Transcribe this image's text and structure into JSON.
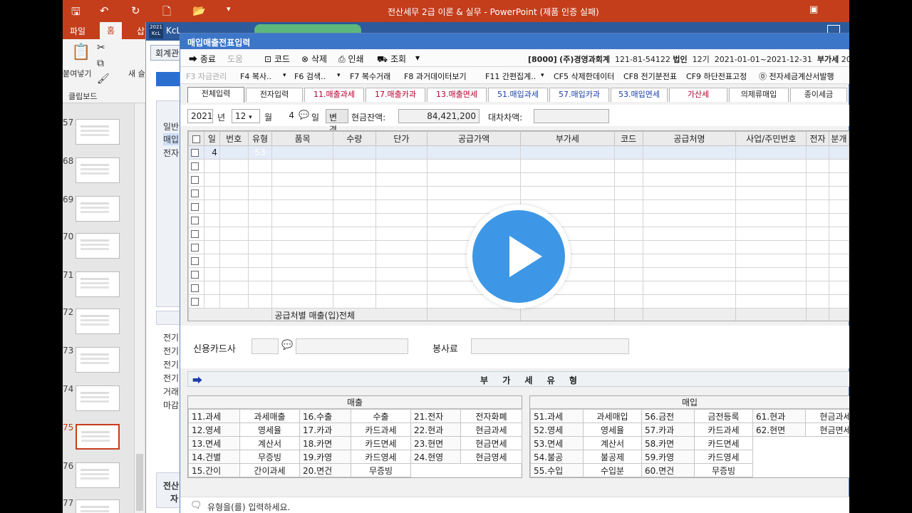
{
  "ppt": {
    "title": "전산세무 2급 이론 & 실무 - PowerPoint (제품 인증 실패)",
    "tabs": [
      "파일",
      "홈",
      "삽"
    ],
    "ribbon": {
      "paste": "붙여넣기",
      "new": "새 슬",
      "clipboard": "클립보드"
    },
    "thumb_numbers": [
      "57",
      "68",
      "69",
      "70",
      "71",
      "72",
      "73",
      "74",
      "75",
      "76",
      "77"
    ]
  },
  "bgapp": {
    "name": "KcL",
    "menu": "회계관",
    "side_items": [
      "일반",
      "매입",
      "전자"
    ],
    "side_items2": [
      "전기",
      "전기",
      "전기",
      "전기",
      "거래",
      "마감"
    ],
    "side_items3": [
      "전산",
      "자"
    ]
  },
  "dialog": {
    "title": "매입매출전표입력",
    "toolbar": {
      "close": "종료",
      "help": "도움",
      "code": "코드",
      "delete": "삭제",
      "print": "인쇄",
      "search": "조회",
      "company_code": "[8000]",
      "company": "(주)경영과회계",
      "biz_no": "121-81-54122",
      "type": "법인",
      "period_no": "12기",
      "period": "2021-01-01~2021-12-31",
      "vat": "부가세",
      "year_partial": "20"
    },
    "fkeys": [
      "F3 자금관리",
      "F4 복사..",
      "F6 검색..",
      "F7 복수거래",
      "F8 과거데이터보기",
      "F11 간편집계..",
      "CF5 삭제한데이터",
      "CF8 전기분전표",
      "CF9 하단전표고정",
      "전자세금계산서발행"
    ],
    "tabs": [
      "전체입력",
      "전자입력",
      "11.매출과세",
      "17.매출카과",
      "13.매출면세",
      "51.매입과세",
      "57.매입카과",
      "53.매입면세",
      "가산세",
      "의제류매입",
      "종이세금"
    ],
    "date": {
      "year": "2021",
      "year_label": "년",
      "month": "12",
      "month_label": "월",
      "day": "4",
      "day_label": "일",
      "change": "변경",
      "cash_label": "현금잔액:",
      "cash_value": "84,421,200",
      "diff_label": "대차차액:"
    },
    "grid": {
      "headers": [
        "일",
        "번호",
        "유형",
        "품목",
        "수량",
        "단가",
        "공급가액",
        "부가세",
        "코드",
        "공급처명",
        "사업/주민번호",
        "전자",
        "분개"
      ],
      "first_row": {
        "day": "4",
        "type": "53"
      },
      "summary": "공급처별 매출(입)전체"
    },
    "card": {
      "card_label": "신용카드사",
      "service_label": "봉사료"
    },
    "vat_title": "부 가 세 유 형",
    "sales": {
      "title": "매출",
      "rows": [
        [
          "11.과세",
          "과세매출",
          "16.수출",
          "수출",
          "21.전자",
          "전자화폐"
        ],
        [
          "12.영세",
          "영세율",
          "17.카과",
          "카드과세",
          "22.현과",
          "현금과세"
        ],
        [
          "13.면세",
          "계산서",
          "18.카면",
          "카드면세",
          "23.현면",
          "현금면세"
        ],
        [
          "14.건별",
          "무증빙",
          "19.카영",
          "카드영세",
          "24.현영",
          "현금영세"
        ],
        [
          "15.간이",
          "간이과세",
          "20.면건",
          "무증빙",
          "",
          ""
        ]
      ]
    },
    "purchase": {
      "title": "매입",
      "rows": [
        [
          "51.과세",
          "과세매입",
          "56.금전",
          "금전등록",
          "61.현과",
          "현금과세"
        ],
        [
          "52.영세",
          "영세율",
          "57.카과",
          "카드과세",
          "62.현면",
          "현금면세"
        ],
        [
          "53.면세",
          "계산서",
          "58.카면",
          "카드면세",
          "",
          ""
        ],
        [
          "54.불공",
          "불공제",
          "59.카영",
          "카드영세",
          "",
          ""
        ],
        [
          "55.수입",
          "수입분",
          "60.면건",
          "무증빙",
          "",
          ""
        ]
      ]
    },
    "status": "유형을(를) 입력하세요."
  },
  "colors": {
    "ppt_brand": "#c43e1c",
    "dialog_title": "#3b76c9",
    "play": "#3d97e6"
  },
  "icons": {
    "play": "play-icon"
  }
}
